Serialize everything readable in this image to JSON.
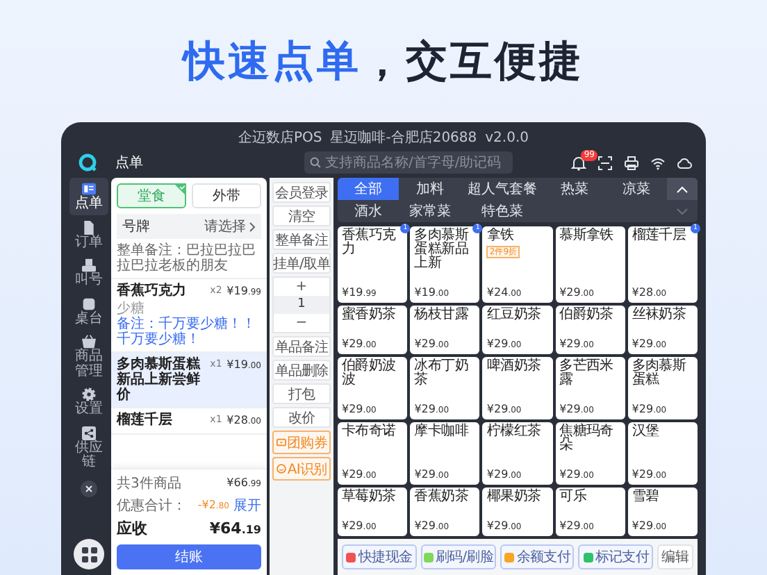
{
  "headline": {
    "highlight": "快速点单",
    "rest": "，交互便捷"
  },
  "window": {
    "title": "企迈数店POS",
    "store": "星迈咖啡-合肥店20688",
    "version": "v2.0.0"
  },
  "header": {
    "page_title": "点单",
    "search": {
      "placeholder": "支持商品名称/首字母/助记码"
    },
    "notification_badge": "99"
  },
  "sidebar": {
    "items": [
      {
        "label": "点单",
        "kind": "order",
        "selected": true
      },
      {
        "label": "订单",
        "kind": "document",
        "selected": false
      },
      {
        "label": "叫号",
        "kind": "call",
        "selected": false
      },
      {
        "label": "桌台",
        "kind": "table",
        "selected": false
      },
      {
        "label": "商品管理",
        "kind": "goods",
        "selected": false
      },
      {
        "label": "设置",
        "kind": "settings",
        "selected": false
      },
      {
        "label": "供应链",
        "kind": "share",
        "selected": false
      }
    ]
  },
  "order": {
    "dine_options": [
      {
        "label": "堂食",
        "selected": true
      },
      {
        "label": "外带",
        "selected": false
      }
    ],
    "number_plate": {
      "label": "号牌",
      "value": "请选择"
    },
    "whole_note": "整单备注：巴拉巴拉巴拉巴拉老板的朋友",
    "items": [
      {
        "name": "香蕉巧克力",
        "qty": "x2",
        "price": {
          "main": "¥19",
          "cents": ".99"
        },
        "spec": "少糖",
        "note": "备注：千万要少糖！！千万要少糖！",
        "selected": false
      },
      {
        "name": "多肉慕斯蛋糕新品上新尝鲜价",
        "qty": "x1",
        "price": {
          "main": "¥19",
          "cents": ".00"
        },
        "selected": true
      },
      {
        "name": "榴莲千层",
        "qty": "x1",
        "price": {
          "main": "¥28",
          "cents": ".00"
        },
        "selected": false
      }
    ],
    "summary": {
      "count_label": "共3件商品",
      "total": {
        "main": "¥66",
        "cents": ".99"
      },
      "discount_label": "优惠合计：",
      "discount": {
        "main": "-¥2",
        "cents": ".80"
      },
      "expand": "展开",
      "due_label": "应收",
      "due": {
        "main": "¥64",
        "cents": ".19"
      },
      "checkout": "结账"
    }
  },
  "actions": [
    {
      "kind": "button",
      "label": "会员登录"
    },
    {
      "kind": "button",
      "label": "清空"
    },
    {
      "kind": "button",
      "label": "整单备注"
    },
    {
      "kind": "button",
      "label": "挂单/取单"
    },
    {
      "kind": "stepper",
      "plus": "+",
      "value": "1",
      "minus": "−"
    },
    {
      "kind": "button",
      "label": "单品备注"
    },
    {
      "kind": "button",
      "label": "单品删除"
    },
    {
      "kind": "button",
      "label": "打包"
    },
    {
      "kind": "button",
      "label": "改价"
    },
    {
      "kind": "coupon",
      "label": "团购券"
    },
    {
      "kind": "ai",
      "label": "AI识别"
    }
  ],
  "categories": [
    {
      "label": "全部",
      "selected": true
    },
    {
      "label": "加料",
      "selected": false
    },
    {
      "label": "超人气套餐",
      "selected": false
    },
    {
      "label": "热菜",
      "selected": false
    },
    {
      "label": "凉菜",
      "selected": false
    },
    {
      "label": "酒水",
      "selected": false
    },
    {
      "label": "家常菜",
      "selected": false
    },
    {
      "label": "特色菜",
      "selected": false
    }
  ],
  "products": [
    {
      "name": "香蕉巧克力",
      "price": {
        "main": "¥19",
        "cents": ".99"
      },
      "badge": "1"
    },
    {
      "name": "多肉慕斯蛋糕新品上新",
      "price": {
        "main": "¥19",
        "cents": ".00"
      },
      "badge": "1"
    },
    {
      "name": "拿铁",
      "price": {
        "main": "¥24",
        "cents": ".00"
      },
      "tag": "2件9折"
    },
    {
      "name": "慕斯拿铁",
      "price": {
        "main": "¥29",
        "cents": ".00"
      }
    },
    {
      "name": "榴莲千层",
      "price": {
        "main": "¥28",
        "cents": ".00"
      },
      "badge": "1"
    },
    {
      "name": "蜜香奶茶",
      "price": {
        "main": "¥29",
        "cents": ".00"
      }
    },
    {
      "name": "杨枝甘露",
      "price": {
        "main": "¥29",
        "cents": ".00"
      }
    },
    {
      "name": "红豆奶茶",
      "price": {
        "main": "¥29",
        "cents": ".00"
      }
    },
    {
      "name": "伯爵奶茶",
      "price": {
        "main": "¥29",
        "cents": ".00"
      }
    },
    {
      "name": "丝袜奶茶",
      "price": {
        "main": "¥29",
        "cents": ".00"
      }
    },
    {
      "name": "伯爵奶波波",
      "price": {
        "main": "¥29",
        "cents": ".00"
      }
    },
    {
      "name": "冰布丁奶茶",
      "price": {
        "main": "¥29",
        "cents": ".00"
      }
    },
    {
      "name": "啤酒奶茶",
      "price": {
        "main": "¥29",
        "cents": ".00"
      }
    },
    {
      "name": "多芒西米露",
      "price": {
        "main": "¥29",
        "cents": ".00"
      }
    },
    {
      "name": "多肉慕斯蛋糕",
      "price": {
        "main": "¥29",
        "cents": ".00"
      }
    },
    {
      "name": "卡布奇诺",
      "price": {
        "main": "¥29",
        "cents": ".00"
      }
    },
    {
      "name": "摩卡咖啡",
      "price": {
        "main": "¥29",
        "cents": ".00"
      }
    },
    {
      "name": "柠檬红茶",
      "price": {
        "main": "¥29",
        "cents": ".00"
      }
    },
    {
      "name": "焦糖玛奇朵",
      "price": {
        "main": "¥29",
        "cents": ".00"
      }
    },
    {
      "name": "汉堡",
      "price": {
        "main": "¥29",
        "cents": ".00"
      }
    },
    {
      "name": "草莓奶茶",
      "price": {
        "main": "¥29",
        "cents": ".00"
      }
    },
    {
      "name": "香蕉奶茶",
      "price": {
        "main": "¥29",
        "cents": ".00"
      }
    },
    {
      "name": "椰果奶茶",
      "price": {
        "main": "¥29",
        "cents": ".00"
      }
    },
    {
      "name": "可乐",
      "price": {
        "main": "¥29",
        "cents": ".00"
      }
    },
    {
      "name": "雪碧",
      "price": {
        "main": "¥29",
        "cents": ".00"
      }
    }
  ],
  "payments": [
    {
      "label": "快捷现金",
      "color": "#f05252"
    },
    {
      "label": "刷码/刷脸",
      "color": "#7ed957"
    },
    {
      "label": "余额支付",
      "color": "#f7a623"
    },
    {
      "label": "标记支付",
      "color": "#2fc26b"
    }
  ],
  "edit": "编辑"
}
